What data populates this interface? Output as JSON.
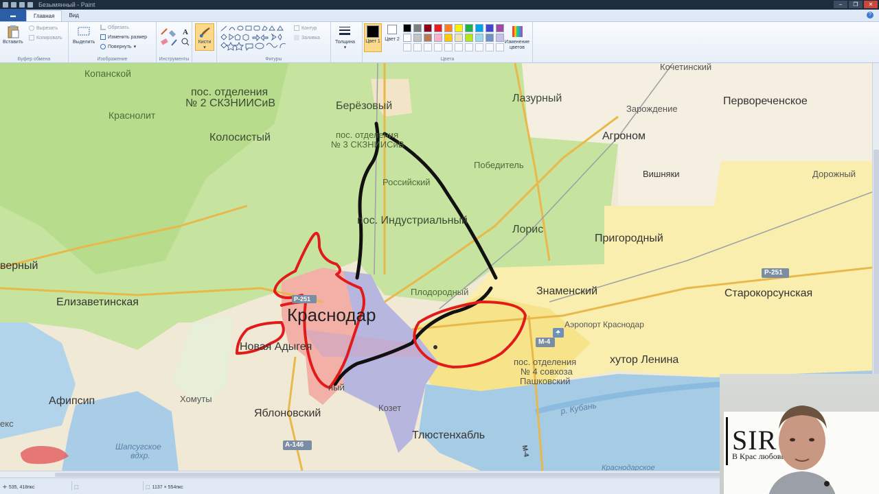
{
  "window": {
    "title": "Безымянный - Paint"
  },
  "tabs": {
    "file": "▬",
    "home": "Главная",
    "view": "Вид"
  },
  "ribbon": {
    "clipboard": {
      "paste": "Вставить",
      "cut": "Вырезать",
      "copy": "Копировать",
      "label": "Буфер обмена"
    },
    "image": {
      "select": "Выделить",
      "crop": "Обрезать",
      "resize": "Изменить размер",
      "rotate": "Повернуть",
      "label": "Изображение"
    },
    "tools": {
      "label": "Инструменты"
    },
    "brushes": {
      "label": "Кисти"
    },
    "shapes": {
      "outline": "Контур",
      "fill": "Заливка",
      "label": "Фигуры"
    },
    "size": {
      "label": "Толщина"
    },
    "colors": {
      "color1": "Цвет 1",
      "color2": "Цвет 2",
      "edit": "Изменение цветов",
      "label": "Цвета"
    }
  },
  "palette": [
    "#000000",
    "#7f7f7f",
    "#880015",
    "#ed1c24",
    "#ff7f27",
    "#fff200",
    "#22b14c",
    "#00a2e8",
    "#3f48cc",
    "#a349a4",
    "#ffffff",
    "#c3c3c3",
    "#b97a57",
    "#ffaec9",
    "#ffc90e",
    "#efe4b0",
    "#b5e61d",
    "#99d9ea",
    "#7092be",
    "#c8bfe7",
    "#ffffff",
    "#ffffff",
    "#ffffff",
    "#ffffff",
    "#ffffff",
    "#ffffff",
    "#ffffff",
    "#ffffff",
    "#ffffff",
    "#ffffff"
  ],
  "colors_state": {
    "color1": "#000000",
    "color2": "#ffffff"
  },
  "map": {
    "labels": {
      "kopanskoy": "Копанской",
      "krasnolit": "Краснолит",
      "pos2": "пос. отделения",
      "pos2b": "№ 2 СКЗНИИСиВ",
      "kolosisty": "Колосистый",
      "berezovy": "Берёзовый",
      "pos3": "пос. отделения",
      "pos3b": "№ 3 СКЗНИИСиВ",
      "lazurny": "Лазурный",
      "kochetinsky": "Кочетинский",
      "zarozhdenie": "Зарождение",
      "pervorechenskoe": "Первореченское",
      "agronom": "Агроном",
      "pobeditel": "Победитель",
      "rossiysky": "Российский",
      "vishnyaki": "Вишняки",
      "dorozhny": "Дорожный",
      "industrialny": "пос. Индустриальный",
      "loris": "Лорис",
      "prigorodny": "Пригородный",
      "severny": "верный",
      "elizavetinskaya": "Елизаветинская",
      "plodorodny": "Плодородный",
      "znamensky": "Знаменский",
      "starokorsunskaya": "Старокорсунская",
      "krasnodar": "Краснодар",
      "airport": "Аэропорт Краснодар",
      "novaya_adygeya": "Новая Адыгея",
      "pos4a": "пос. отделения",
      "pos4b": "№ 4 совхоза",
      "pos4c": "Пашковский",
      "khutor_lenina": "хутор Ленина",
      "afipsip": "Афипсип",
      "khomuty": "Хомуты",
      "yablonovsky": "Яблоновский",
      "kozet": "Козет",
      "tlyustenkhabl": "Тлюстенхабль",
      "kubyn": "р. Кубань",
      "shapsugskoe1": "Шапсугское",
      "shapsugskoe2": "вдхр.",
      "eks": "екс",
      "krasnodarskoe": "Краснодарское",
      "znamensky_short": "ный",
      "r251": "Р-251",
      "r251b": "Р-251",
      "m4": "М-4",
      "m4b": "М-4",
      "a146": "А-146"
    }
  },
  "status": {
    "cursor": "535, 418пкс",
    "selection": "",
    "size": "1137 × 554пкс"
  },
  "webcam": {
    "brand": "SIR     ru",
    "slogan": "В Крас        любовью!"
  }
}
